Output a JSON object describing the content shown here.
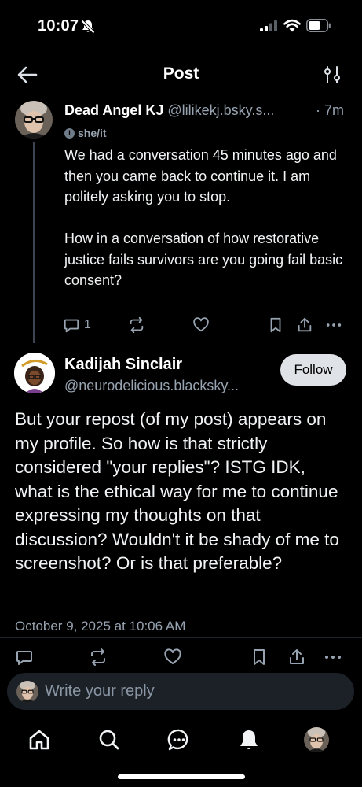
{
  "status_bar": {
    "time": "10:07"
  },
  "header": {
    "title": "Post"
  },
  "parent_post": {
    "author_name": "Dead Angel KJ",
    "author_handle": "@lilikekj.bsky.s...",
    "time": "· 7m",
    "pronouns": "she/it",
    "text": "We had a conversation 45 minutes ago and then you came back to continue it. I am politely asking you to stop.\n\nHow in a conversation of how restorative justice fails survivors are you going fail basic consent?",
    "reply_count": "1"
  },
  "main_post": {
    "author_name": "Kadijah Sinclair",
    "author_handle": "@neurodelicious.blacksky...",
    "follow_label": "Follow",
    "text": "But your repost (of my post) appears on my profile. So how is that strictly considered \"your replies\"? ISTG IDK, what is the ethical way for me to continue expressing my thoughts on that discussion? Wouldn't it be shady of me to screenshot? Or is that preferable?",
    "date": "October 9, 2025 at 10:06 AM"
  },
  "reply_bar": {
    "placeholder": "Write your reply"
  },
  "colors": {
    "background": "#000000",
    "muted_text": "#97a3b0",
    "follow_button_bg": "#dfe3e8",
    "reply_bar_bg": "#1c2128"
  },
  "icons": {
    "status": [
      "bell-slash-icon",
      "signal-icon",
      "wifi-icon",
      "battery-icon"
    ],
    "header": [
      "back-arrow-icon",
      "sliders-icon"
    ],
    "actions": [
      "reply-icon",
      "repost-icon",
      "like-icon",
      "bookmark-icon",
      "share-icon",
      "more-icon"
    ],
    "tabs": [
      "home-icon",
      "search-icon",
      "chat-icon",
      "notifications-icon",
      "profile-avatar"
    ]
  }
}
